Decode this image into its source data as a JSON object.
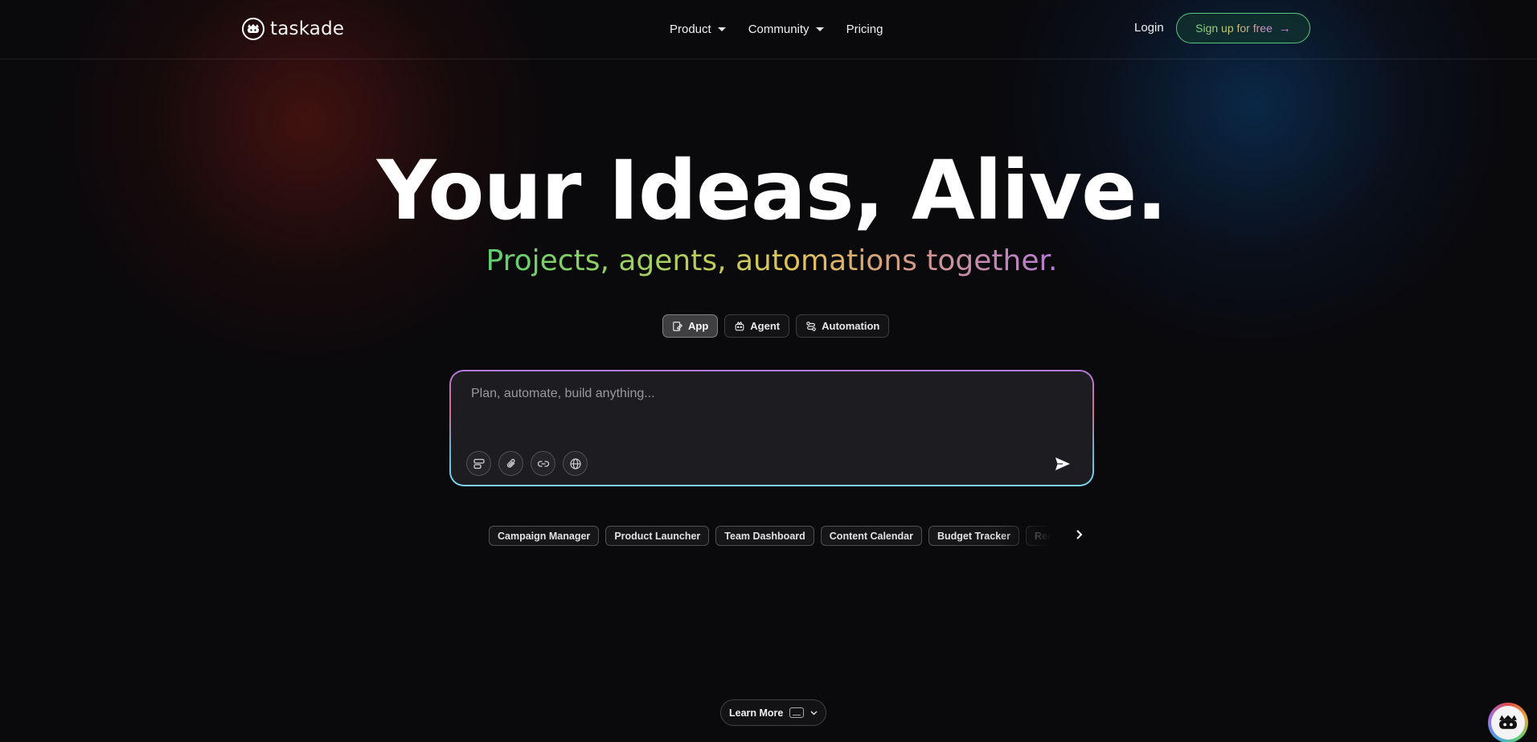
{
  "brand": {
    "name": "taskade",
    "logo_icon": "taskade-bot-icon"
  },
  "nav": {
    "items": [
      {
        "label": "Product",
        "has_dropdown": true
      },
      {
        "label": "Community",
        "has_dropdown": true
      },
      {
        "label": "Pricing",
        "has_dropdown": false
      }
    ],
    "login_label": "Login",
    "signup_label": "Sign up for free"
  },
  "hero": {
    "title": "Your Ideas, Alive.",
    "subtitle": "Projects, agents, automations together."
  },
  "mode_tabs": [
    {
      "label": "App",
      "icon": "app-icon",
      "active": true
    },
    {
      "label": "Agent",
      "icon": "agent-icon",
      "active": false
    },
    {
      "label": "Automation",
      "icon": "automation-icon",
      "active": false
    }
  ],
  "prompt": {
    "placeholder": "Plan, automate, build anything...",
    "value": "",
    "tools": [
      "layout-icon",
      "paperclip-icon",
      "link-icon",
      "globe-icon"
    ],
    "send_icon": "send-icon"
  },
  "templates": [
    "Campaign Manager",
    "Product Launcher",
    "Team Dashboard",
    "Content Calendar",
    "Budget Tracker",
    "Recruitment Hub"
  ],
  "learn_more": {
    "label": "Learn More"
  },
  "colors": {
    "background": "#0a090c",
    "accent_green": "#55c97c",
    "accent_purple": "#b77ad6"
  }
}
